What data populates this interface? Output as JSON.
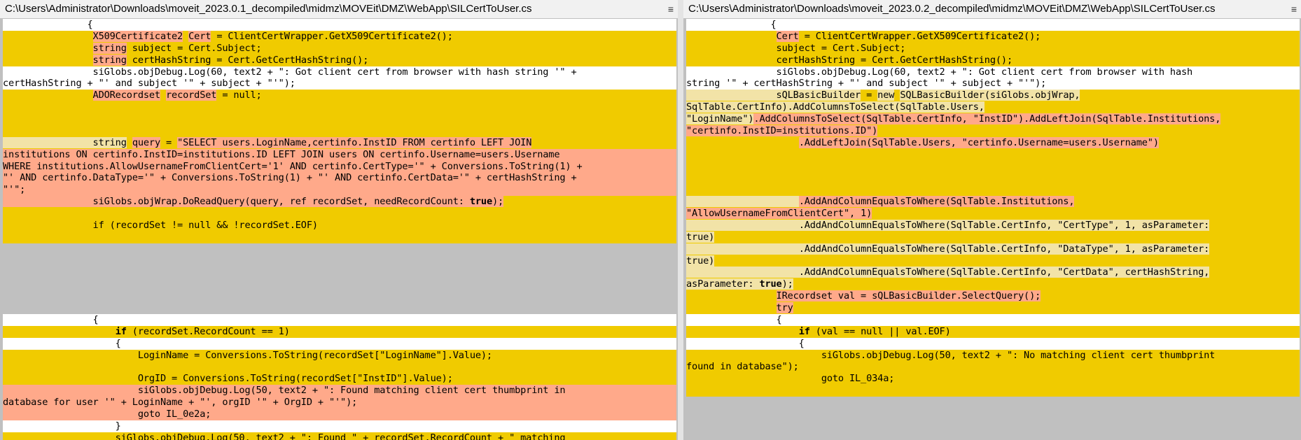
{
  "left": {
    "title": "C:\\Users\\Administrator\\Downloads\\moveit_2023.0.1_decompiled\\midmz\\MOVEit\\DMZ\\WebApp\\SILCertToUser.cs",
    "lines": [
      {
        "bg": "w",
        "segs": [
          [
            "",
            "               {"
          ]
        ]
      },
      {
        "bg": "y",
        "segs": [
          [
            "",
            "                "
          ],
          [
            "o",
            "X509Certificate2"
          ],
          [
            "",
            " "
          ],
          [
            "o",
            "Cert"
          ],
          [
            "",
            " = ClientCertWrapper.GetX509Certificate2();"
          ]
        ]
      },
      {
        "bg": "y",
        "segs": [
          [
            "",
            "                "
          ],
          [
            "o",
            "string"
          ],
          [
            "",
            " subject = Cert.Subject;"
          ]
        ]
      },
      {
        "bg": "y",
        "segs": [
          [
            "",
            "                "
          ],
          [
            "o",
            "string"
          ],
          [
            "",
            " certHashString = Cert.GetCertHashString();"
          ]
        ]
      },
      {
        "bg": "w",
        "segs": [
          [
            "",
            "                siGlobs.objDebug.Log(60, text2 + \": Got client cert from browser with hash string '\" +"
          ]
        ]
      },
      {
        "bg": "w",
        "segs": [
          [
            "",
            "certHashString + \"' and subject '\" + subject + \"'\");"
          ]
        ]
      },
      {
        "bg": "y",
        "segs": [
          [
            "",
            "                "
          ],
          [
            "o",
            "ADORecordset"
          ],
          [
            "",
            " "
          ],
          [
            "o",
            "recordSet"
          ],
          [
            "",
            " = null;"
          ]
        ]
      },
      {
        "bg": "y",
        "segs": [
          [
            "",
            ""
          ]
        ]
      },
      {
        "bg": "y",
        "segs": [
          [
            "",
            ""
          ]
        ]
      },
      {
        "bg": "y",
        "segs": [
          [
            "",
            ""
          ]
        ]
      },
      {
        "bg": "y",
        "segs": [
          [
            "c",
            "                "
          ],
          [
            "c",
            "string"
          ],
          [
            "",
            " "
          ],
          [
            "o",
            "query"
          ],
          [
            "",
            " = "
          ],
          [
            "o",
            "\"SELECT users.LoginName,certinfo.InstID FROM certinfo LEFT JOIN"
          ]
        ]
      },
      {
        "bg": "o",
        "segs": [
          [
            "o",
            "institutions ON certinfo.InstID=institutions.ID LEFT JOIN users ON certinfo.Username=users.Username"
          ]
        ]
      },
      {
        "bg": "o",
        "segs": [
          [
            "o",
            "WHERE institutions.AllowUsernameFromClientCert='1' AND certinfo.CertType='\" + Conversions.ToString(1) +"
          ]
        ]
      },
      {
        "bg": "o",
        "segs": [
          [
            "o",
            "\"' AND certinfo.DataType='\" + Conversions.ToString(1) + \"' AND certinfo.CertData='\" + certHashString +"
          ]
        ]
      },
      {
        "bg": "o",
        "segs": [
          [
            "o",
            "\"'\";"
          ]
        ]
      },
      {
        "bg": "y",
        "segs": [
          [
            "o",
            "                siGlobs.objWrap.DoReadQuery(query, ref recordSet, needRecordCount: "
          ],
          [
            "ob",
            "true"
          ],
          [
            "o",
            ");"
          ]
        ]
      },
      {
        "bg": "y",
        "segs": [
          [
            "",
            ""
          ]
        ]
      },
      {
        "bg": "y",
        "segs": [
          [
            "",
            "                if (recordSet != null && !recordSet.EOF)"
          ]
        ]
      },
      {
        "bg": "y",
        "segs": [
          [
            "",
            ""
          ]
        ]
      },
      {
        "bg": "g",
        "segs": [
          [
            "",
            ""
          ]
        ]
      },
      {
        "bg": "g",
        "segs": [
          [
            "",
            ""
          ]
        ]
      },
      {
        "bg": "g",
        "segs": [
          [
            "",
            ""
          ]
        ]
      },
      {
        "bg": "g",
        "segs": [
          [
            "",
            ""
          ]
        ]
      },
      {
        "bg": "g",
        "segs": [
          [
            "",
            ""
          ]
        ]
      },
      {
        "bg": "g",
        "segs": [
          [
            "",
            ""
          ]
        ]
      },
      {
        "bg": "w",
        "segs": [
          [
            "",
            "                {"
          ]
        ]
      },
      {
        "bg": "y",
        "segs": [
          [
            "",
            "                    "
          ],
          [
            "b",
            "if"
          ],
          [
            "",
            " (recordSet.RecordCount == 1)"
          ]
        ]
      },
      {
        "bg": "w",
        "segs": [
          [
            "",
            "                    {"
          ]
        ]
      },
      {
        "bg": "y",
        "segs": [
          [
            "",
            "                        LoginName = Conversions.ToString(recordSet[\"LoginName\"].Value);"
          ]
        ]
      },
      {
        "bg": "y",
        "segs": [
          [
            "",
            ""
          ]
        ]
      },
      {
        "bg": "y",
        "segs": [
          [
            "",
            "                        OrgID = Conversions.ToString(recordSet[\"InstID\"].Value);"
          ]
        ]
      },
      {
        "bg": "o",
        "segs": [
          [
            "",
            "                        siGlobs.objDebug.Log(50, text2 + \": Found matching client cert thumbprint in"
          ]
        ]
      },
      {
        "bg": "o",
        "segs": [
          [
            "",
            "database for user '\" + LoginName + \"', orgID '\" + OrgID + \"'\");"
          ]
        ]
      },
      {
        "bg": "o",
        "segs": [
          [
            "",
            "                        goto IL_0e2a;"
          ]
        ]
      },
      {
        "bg": "w",
        "segs": [
          [
            "",
            "                    }"
          ]
        ]
      },
      {
        "bg": "y",
        "segs": [
          [
            "",
            "                    siGlobs.objDebug.Log(50, text2 + \": Found \" + recordSet.RecordCount + \" matching"
          ]
        ]
      }
    ]
  },
  "right": {
    "title": "C:\\Users\\Administrator\\Downloads\\moveit_2023.0.2_decompiled\\midmz\\MOVEit\\DMZ\\WebApp\\SILCertToUser.cs",
    "lines": [
      {
        "bg": "w",
        "segs": [
          [
            "",
            "               {"
          ]
        ]
      },
      {
        "bg": "y",
        "segs": [
          [
            "",
            "                "
          ],
          [
            "o",
            "Cert"
          ],
          [
            "",
            " = ClientCertWrapper.GetX509Certificate2();"
          ]
        ]
      },
      {
        "bg": "y",
        "segs": [
          [
            "",
            "                subject = Cert.Subject;"
          ]
        ]
      },
      {
        "bg": "y",
        "segs": [
          [
            "",
            "                certHashString = Cert.GetCertHashString();"
          ]
        ]
      },
      {
        "bg": "w",
        "segs": [
          [
            "",
            "                siGlobs.objDebug.Log(60, text2 + \": Got client cert from browser with hash"
          ]
        ]
      },
      {
        "bg": "w",
        "segs": [
          [
            "",
            "string '\" + certHashString + \"' and subject '\" + subject + \"'\");"
          ]
        ]
      },
      {
        "bg": "y",
        "segs": [
          [
            "c",
            "                sQLBasicBuilder"
          ],
          [
            "",
            " = "
          ],
          [
            "c",
            "new"
          ],
          [
            "",
            " "
          ],
          [
            "c",
            "SQLBasicBuilder(siGlobs.objWrap,"
          ]
        ]
      },
      {
        "bg": "y",
        "segs": [
          [
            "c",
            "SqlTable.CertInfo).AddColumnsToSelect(SqlTable.Users,"
          ]
        ]
      },
      {
        "bg": "y",
        "segs": [
          [
            "c",
            "\"LoginName\")"
          ],
          [
            "o",
            ".AddColumnsToSelect(SqlTable.CertInfo, \"InstID\").AddLeftJoin(SqlTable.Institutions,"
          ]
        ]
      },
      {
        "bg": "y",
        "segs": [
          [
            "o",
            "\"certinfo.InstID=institutions.ID\")"
          ]
        ]
      },
      {
        "bg": "y",
        "segs": [
          [
            "",
            "                    "
          ],
          [
            "o",
            ".AddLeftJoin(SqlTable.Users, \"certinfo.Username=users.Username\")"
          ]
        ]
      },
      {
        "bg": "y",
        "segs": [
          [
            "",
            ""
          ]
        ]
      },
      {
        "bg": "y",
        "segs": [
          [
            "",
            ""
          ]
        ]
      },
      {
        "bg": "y",
        "segs": [
          [
            "",
            ""
          ]
        ]
      },
      {
        "bg": "y",
        "segs": [
          [
            "",
            ""
          ]
        ]
      },
      {
        "bg": "y",
        "segs": [
          [
            "c",
            "                    "
          ],
          [
            "o",
            ".AddAndColumnEqualsToWhere(SqlTable.Institutions,"
          ]
        ]
      },
      {
        "bg": "y",
        "segs": [
          [
            "o",
            "\"AllowUsernameFromClientCert\", 1)"
          ]
        ]
      },
      {
        "bg": "y",
        "segs": [
          [
            "c",
            "                    "
          ],
          [
            "c",
            ".AddAndColumnEqualsToWhere(SqlTable.CertInfo, \"CertType\", 1, asParameter:"
          ]
        ]
      },
      {
        "bg": "y",
        "segs": [
          [
            "c",
            "true)"
          ]
        ]
      },
      {
        "bg": "y",
        "segs": [
          [
            "c",
            "                    "
          ],
          [
            "c",
            ".AddAndColumnEqualsToWhere(SqlTable.CertInfo, \"DataType\", 1, asParameter:"
          ]
        ]
      },
      {
        "bg": "y",
        "segs": [
          [
            "c",
            "true)"
          ]
        ]
      },
      {
        "bg": "y",
        "segs": [
          [
            "c",
            "                    "
          ],
          [
            "c",
            ".AddAndColumnEqualsToWhere(SqlTable.CertInfo, \"CertData\", certHashString,"
          ]
        ]
      },
      {
        "bg": "y",
        "segs": [
          [
            "c",
            "asParameter: "
          ],
          [
            "cb",
            "true"
          ],
          [
            "c",
            ");"
          ]
        ]
      },
      {
        "bg": "y",
        "segs": [
          [
            "",
            "                "
          ],
          [
            "o",
            "IRecordset val = sQLBasicBuilder.SelectQuery();"
          ]
        ]
      },
      {
        "bg": "y",
        "segs": [
          [
            "",
            "                "
          ],
          [
            "o",
            "try"
          ]
        ]
      },
      {
        "bg": "w",
        "segs": [
          [
            "",
            "                {"
          ]
        ]
      },
      {
        "bg": "y",
        "segs": [
          [
            "",
            "                    "
          ],
          [
            "b",
            "if"
          ],
          [
            "",
            " (val == null || val.EOF)"
          ]
        ]
      },
      {
        "bg": "w",
        "segs": [
          [
            "",
            "                    {"
          ]
        ]
      },
      {
        "bg": "y",
        "segs": [
          [
            "",
            "                        siGlobs.objDebug.Log(50, text2 + \": No matching client cert thumbprint"
          ]
        ]
      },
      {
        "bg": "y",
        "segs": [
          [
            "",
            "found in database\");"
          ]
        ]
      },
      {
        "bg": "y",
        "segs": [
          [
            "",
            "                        goto IL_034a;"
          ]
        ]
      },
      {
        "bg": "y",
        "segs": [
          [
            "",
            ""
          ]
        ]
      },
      {
        "bg": "g",
        "segs": [
          [
            "",
            ""
          ]
        ]
      },
      {
        "bg": "g",
        "segs": [
          [
            "",
            ""
          ]
        ]
      },
      {
        "bg": "g",
        "segs": [
          [
            "",
            ""
          ]
        ]
      },
      {
        "bg": "g",
        "segs": [
          [
            "",
            ""
          ]
        ]
      }
    ]
  },
  "menu_glyph": "≡",
  "colors": {
    "changed": "#f0cb00",
    "inserted": "#ffa98a",
    "moved": "#f2e3a7",
    "equal": "#ffffff",
    "missing": "#c0c0c0"
  }
}
